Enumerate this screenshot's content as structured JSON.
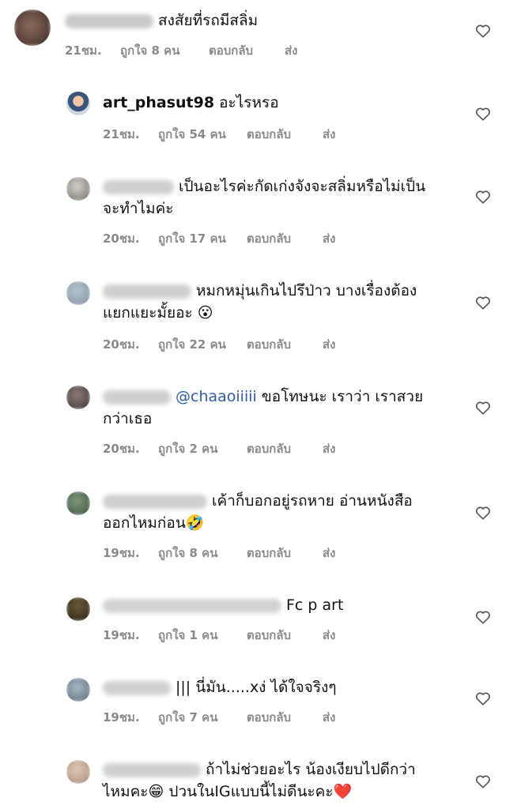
{
  "comments": [
    {
      "text": "สงสัยที่รถมีสลิ่ม",
      "time": "21ชม.",
      "likes": "ถูกใจ 8 คน",
      "reply": "ตอบกลับ",
      "send": "ส่ง"
    },
    {
      "username": "art_phasut98",
      "text": "อะไรหรอ",
      "time": "21ชม.",
      "likes": "ถูกใจ 54 คน",
      "reply": "ตอบกลับ",
      "send": "ส่ง"
    },
    {
      "line1": "เป็นอะไรค่ะกัดเก่งจังจะสลิ่มหรือไม่เป็น",
      "line2": "จะทำไมค่ะ",
      "time": "20ชม.",
      "likes": "ถูกใจ 17 คน",
      "reply": "ตอบกลับ",
      "send": "ส่ง"
    },
    {
      "line1": "หมกหมุ่นเกินไปรึป่าว บางเรื่องต้อง",
      "line2": "แยกแยะมั้ยอะ",
      "emoji": "😮",
      "time": "20ชม.",
      "likes": "ถูกใจ 22 คน",
      "reply": "ตอบกลับ",
      "send": "ส่ง"
    },
    {
      "mention": "@chaaoiiiii",
      "line1": "ขอโทษนะ เราว่า เราสวย",
      "line2": "กว่าเธอ",
      "time": "20ชม.",
      "likes": "ถูกใจ 2 คน",
      "reply": "ตอบกลับ",
      "send": "ส่ง"
    },
    {
      "line1": "เค้าก็บอกอยู่รถหาย อ่านหนังสือ",
      "line2": "ออกไหมก่อน",
      "emoji": "🤣",
      "time": "19ชม.",
      "likes": "ถูกใจ 8 คน",
      "reply": "ตอบกลับ",
      "send": "ส่ง"
    },
    {
      "text": "Fc p art",
      "time": "19ชม.",
      "likes": "ถูกใจ 1 คน",
      "reply": "ตอบกลับ",
      "send": "ส่ง"
    },
    {
      "text": "||| นี่มัน.....xง่ ได้ใจจริงๆ",
      "time": "19ชม.",
      "likes": "ถูกใจ 7 คน",
      "reply": "ตอบกลับ",
      "send": "ส่ง"
    },
    {
      "line1": "ถ้าไม่ช่วยอะไร น้องเงียบไปดีกว่า",
      "line2": "ไหมคะ",
      "emoji2": "😁",
      "line2b": "ปวนในIGแบบนี้ไม่ดีนะคะ",
      "emoji3": "❤️"
    }
  ]
}
